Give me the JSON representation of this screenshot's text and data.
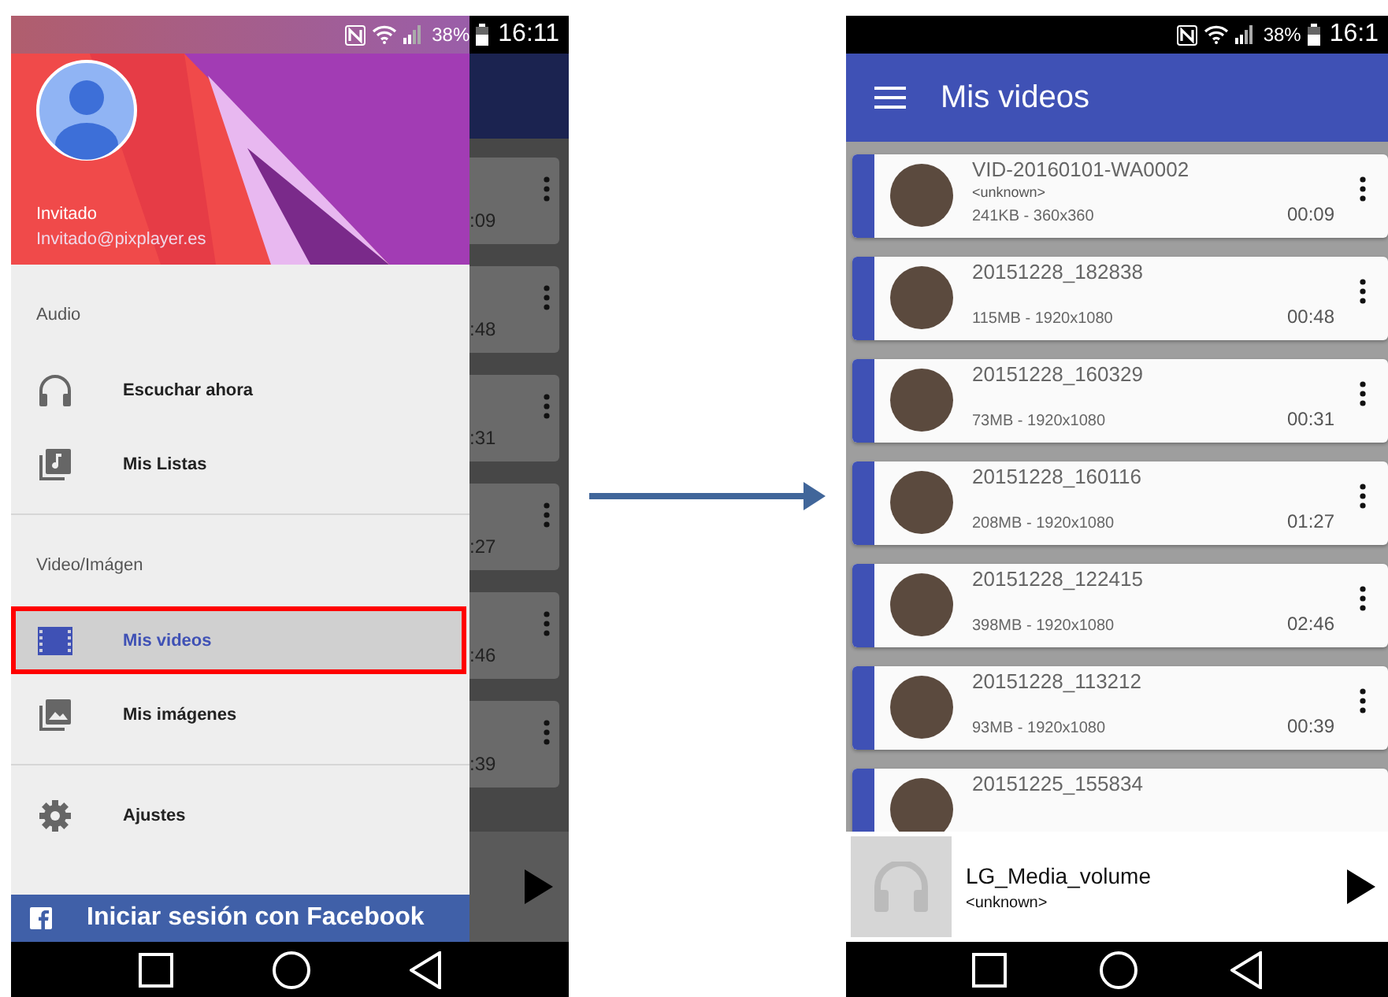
{
  "left_phone": {
    "status_bar": {
      "battery": "38%",
      "time": "16:11"
    },
    "drawer": {
      "user": {
        "name": "Invitado",
        "email": "Invitado@pixplayer.es"
      },
      "sections": [
        {
          "header": "Audio",
          "items": [
            {
              "label": "Escuchar ahora",
              "kind": "headphones",
              "selected": false
            },
            {
              "label": "Mis Listas",
              "kind": "playlist",
              "selected": false
            }
          ]
        },
        {
          "header": "Video/Imágen",
          "items": [
            {
              "label": "Mis videos",
              "kind": "film",
              "selected": true
            },
            {
              "label": "Mis imágenes",
              "kind": "images",
              "selected": false
            }
          ]
        },
        {
          "items": [
            {
              "label": "Ajustes",
              "kind": "gear",
              "selected": false
            }
          ]
        }
      ],
      "facebook_button": "Iniciar sesión con Facebook"
    },
    "background_list": {
      "durations": [
        ":09",
        ":48",
        ":31",
        ":27",
        ":46",
        ":39"
      ]
    }
  },
  "right_phone": {
    "status_bar": {
      "battery": "38%",
      "time": "16:1"
    },
    "app_bar": {
      "title": "Mis videos"
    },
    "videos": [
      {
        "title": "VID-20160101-WA0002",
        "artist": "<unknown>",
        "info": "241KB - 360x360",
        "duration": "00:09"
      },
      {
        "title": "20151228_182838",
        "info": "115MB - 1920x1080",
        "duration": "00:48"
      },
      {
        "title": "20151228_160329",
        "info": "73MB - 1920x1080",
        "duration": "00:31"
      },
      {
        "title": "20151228_160116",
        "info": "208MB - 1920x1080",
        "duration": "01:27"
      },
      {
        "title": "20151228_122415",
        "info": "398MB - 1920x1080",
        "duration": "02:46"
      },
      {
        "title": "20151228_113212",
        "info": "93MB - 1920x1080",
        "duration": "00:39"
      },
      {
        "title": "20151225_155834"
      }
    ],
    "player": {
      "title": "LG_Media_volume",
      "artist": "<unknown>"
    }
  }
}
